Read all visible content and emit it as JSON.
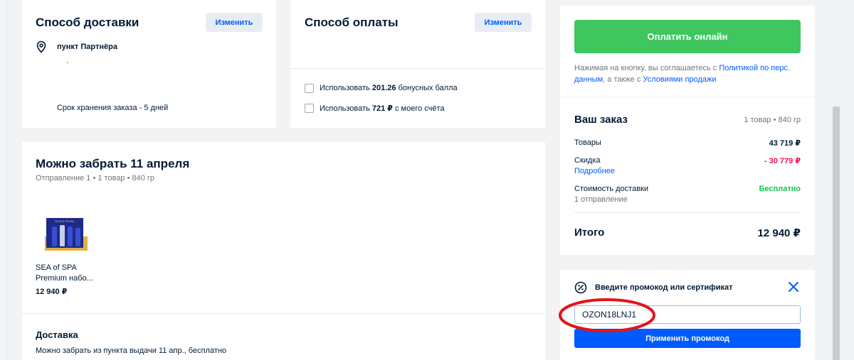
{
  "delivery_card": {
    "title": "Способ доставки",
    "change_label": "Изменить",
    "point_label": "пункт Партнёра",
    "address": "-",
    "storage_text": "Срок хранения заказа - 5 дней"
  },
  "payment_card": {
    "title": "Способ оплаты",
    "change_label": "Изменить",
    "bonus_pre": "Использовать",
    "bonus_amount": "201.26",
    "bonus_post": "бонусных балла",
    "account_pre": "Использовать",
    "account_amount": "721 ₽",
    "account_post": "с моего счёта"
  },
  "pickup_card": {
    "title": "Можно забрать 11 апреля",
    "subtitle": "Отправление 1 • 1 товар • 840 гр",
    "product_name_1": "SEA of SPA",
    "product_name_2": "Premium набо...",
    "product_price": "12 940 ₽",
    "product_box_text": "BLACK PEARL",
    "delivery_heading": "Доставка",
    "delivery_text": "Можно забрать из пункта выдачи 11 апр., бесплатно"
  },
  "pay_card": {
    "pay_button": "Оплатить онлайн",
    "consent_1": "Нажимая на кнопку, вы соглашаетесь с",
    "policy_link_1": "Политикой по перс.",
    "policy_link_2": "данным",
    "consent_2": ", а также с",
    "terms_link": "Условиями продажи"
  },
  "order_card": {
    "title": "Ваш заказ",
    "meta": "1 товар • 840 гр",
    "goods_label": "Товары",
    "goods_value": "43 719 ₽",
    "discount_label": "Скидка",
    "discount_value": "- 30 779 ₽",
    "details_link": "Подробнее",
    "shipping_label": "Стоимость доставки",
    "shipping_value": "Бесплатно",
    "shipping_sub": "1 отправление",
    "total_label": "Итого",
    "total_value": "12 940 ₽"
  },
  "promo_card": {
    "prompt": "Введите промокод или сертификат",
    "code_value": "OZON18LNJ1",
    "apply_button": "Применить промокод"
  },
  "colors": {
    "accent_blue": "#005bff",
    "pay_green": "#3fc65f",
    "discount_red": "#f91155",
    "annotation_red": "#e3141c"
  }
}
